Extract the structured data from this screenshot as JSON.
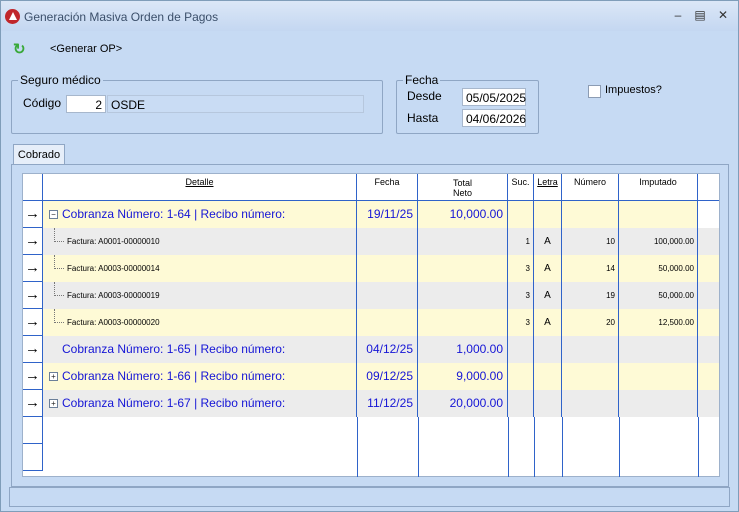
{
  "window": {
    "title": "Generación Masiva Orden de Pagos"
  },
  "toolbar": {
    "generate_label": "<Generar OP>"
  },
  "seguro": {
    "legend": "Seguro médico",
    "codigo_label": "Código",
    "codigo_value": "2",
    "nombre_value": "OSDE"
  },
  "fecha": {
    "legend": "Fecha",
    "desde_label": "Desde",
    "desde_value": "05/05/2025",
    "hasta_label": "Hasta",
    "hasta_value": "04/06/2026"
  },
  "impuestos": {
    "label": "Impuestos?",
    "checked": false
  },
  "tabs": [
    {
      "label": "Cobrado"
    }
  ],
  "grid": {
    "headers": {
      "detalle": "Detalle",
      "fecha": "Fecha",
      "total_l1": "Total",
      "total_l2": "Neto",
      "suc": "Suc.",
      "letra": "Letra",
      "numero": "Número",
      "imputado": "Imputado"
    },
    "rows": [
      {
        "type": "main",
        "expander": "−",
        "detalle": "Cobranza Número: 1-64 | Recibo número:",
        "fecha": "19/11/25",
        "total": "10,000.00",
        "suc": "",
        "letra": "",
        "numero": "",
        "imputado": "",
        "bg": "#fefad6"
      },
      {
        "type": "sub",
        "detalle": "Factura: A0001-00000010",
        "suc": "1",
        "letra": "A",
        "numero": "10",
        "imputado": "100,000.00",
        "bg": "#ececec"
      },
      {
        "type": "sub",
        "detalle": "Factura: A0003-00000014",
        "suc": "3",
        "letra": "A",
        "numero": "14",
        "imputado": "50,000.00",
        "bg": "#fefad6"
      },
      {
        "type": "sub",
        "detalle": "Factura: A0003-00000019",
        "suc": "3",
        "letra": "A",
        "numero": "19",
        "imputado": "50,000.00",
        "bg": "#ececec"
      },
      {
        "type": "sub",
        "detalle": "Factura: A0003-00000020",
        "suc": "3",
        "letra": "A",
        "numero": "20",
        "imputado": "12,500.00",
        "bg": "#fefad6"
      },
      {
        "type": "main",
        "expander": "",
        "detalle": "Cobranza Número: 1-65 | Recibo número:",
        "fecha": "04/12/25",
        "total": "1,000.00",
        "suc": "",
        "letra": "",
        "numero": "",
        "imputado": "",
        "bg": "#ececec"
      },
      {
        "type": "main",
        "expander": "+",
        "detalle": "Cobranza Número: 1-66 | Recibo número:",
        "fecha": "09/12/25",
        "total": "9,000.00",
        "suc": "",
        "letra": "",
        "numero": "",
        "imputado": "",
        "bg": "#fefad6"
      },
      {
        "type": "main",
        "expander": "+",
        "detalle": "Cobranza Número: 1-67 | Recibo número:",
        "fecha": "11/12/25",
        "total": "20,000.00",
        "suc": "",
        "letra": "",
        "numero": "",
        "imputado": "",
        "bg": "#ececec"
      }
    ],
    "row_indicator": "→"
  }
}
